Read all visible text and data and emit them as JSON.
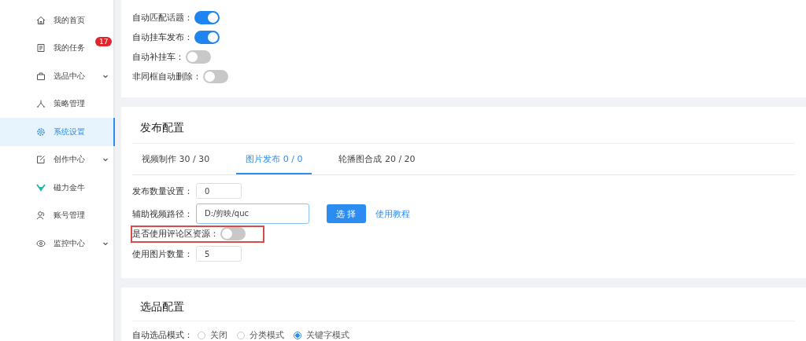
{
  "sidebar": {
    "items": [
      {
        "label": "我的首页",
        "selected": false
      },
      {
        "label": "我的任务",
        "selected": false,
        "badge": "17"
      },
      {
        "label": "选品中心",
        "selected": false,
        "expandable": true
      },
      {
        "label": "策略管理",
        "selected": false
      },
      {
        "label": "系统设置",
        "selected": true
      },
      {
        "label": "创作中心",
        "selected": false,
        "expandable": true
      },
      {
        "label": "磁力金牛",
        "selected": false
      },
      {
        "label": "账号管理",
        "selected": false
      },
      {
        "label": "监控中心",
        "selected": false,
        "expandable": true
      }
    ]
  },
  "auto_settings": [
    {
      "label": "自动匹配话题：",
      "on": true
    },
    {
      "label": "自动挂车发布：",
      "on": true
    },
    {
      "label": "自动补挂车：",
      "on": false
    },
    {
      "label": "非同框自动删除：",
      "on": false
    }
  ],
  "publish_config": {
    "title": "发布配置",
    "tabs": [
      {
        "label": "视频制作 30 / 30",
        "selected": false
      },
      {
        "label": "图片发布 0 / 0",
        "selected": true
      },
      {
        "label": "轮播图合成 20 / 20",
        "selected": false
      }
    ],
    "fields": [
      {
        "kind": "input",
        "label": "发布数量设置：",
        "value": "0"
      },
      {
        "kind": "path",
        "label": "辅助视频路径：",
        "value": "D:/剪映/quc",
        "button": "选 择",
        "link": "使用教程"
      },
      {
        "kind": "switch",
        "label": "是否使用评论区资源：",
        "on": false,
        "highlighted": true
      },
      {
        "kind": "input",
        "label": "使用图片数量：",
        "value": "5"
      }
    ]
  },
  "product_config": {
    "title": "选品配置",
    "mode_label": "自动选品模式：",
    "options": [
      {
        "label": "关闭",
        "selected": false
      },
      {
        "label": "分类模式",
        "selected": false
      },
      {
        "label": "关键字模式",
        "selected": true
      }
    ]
  }
}
